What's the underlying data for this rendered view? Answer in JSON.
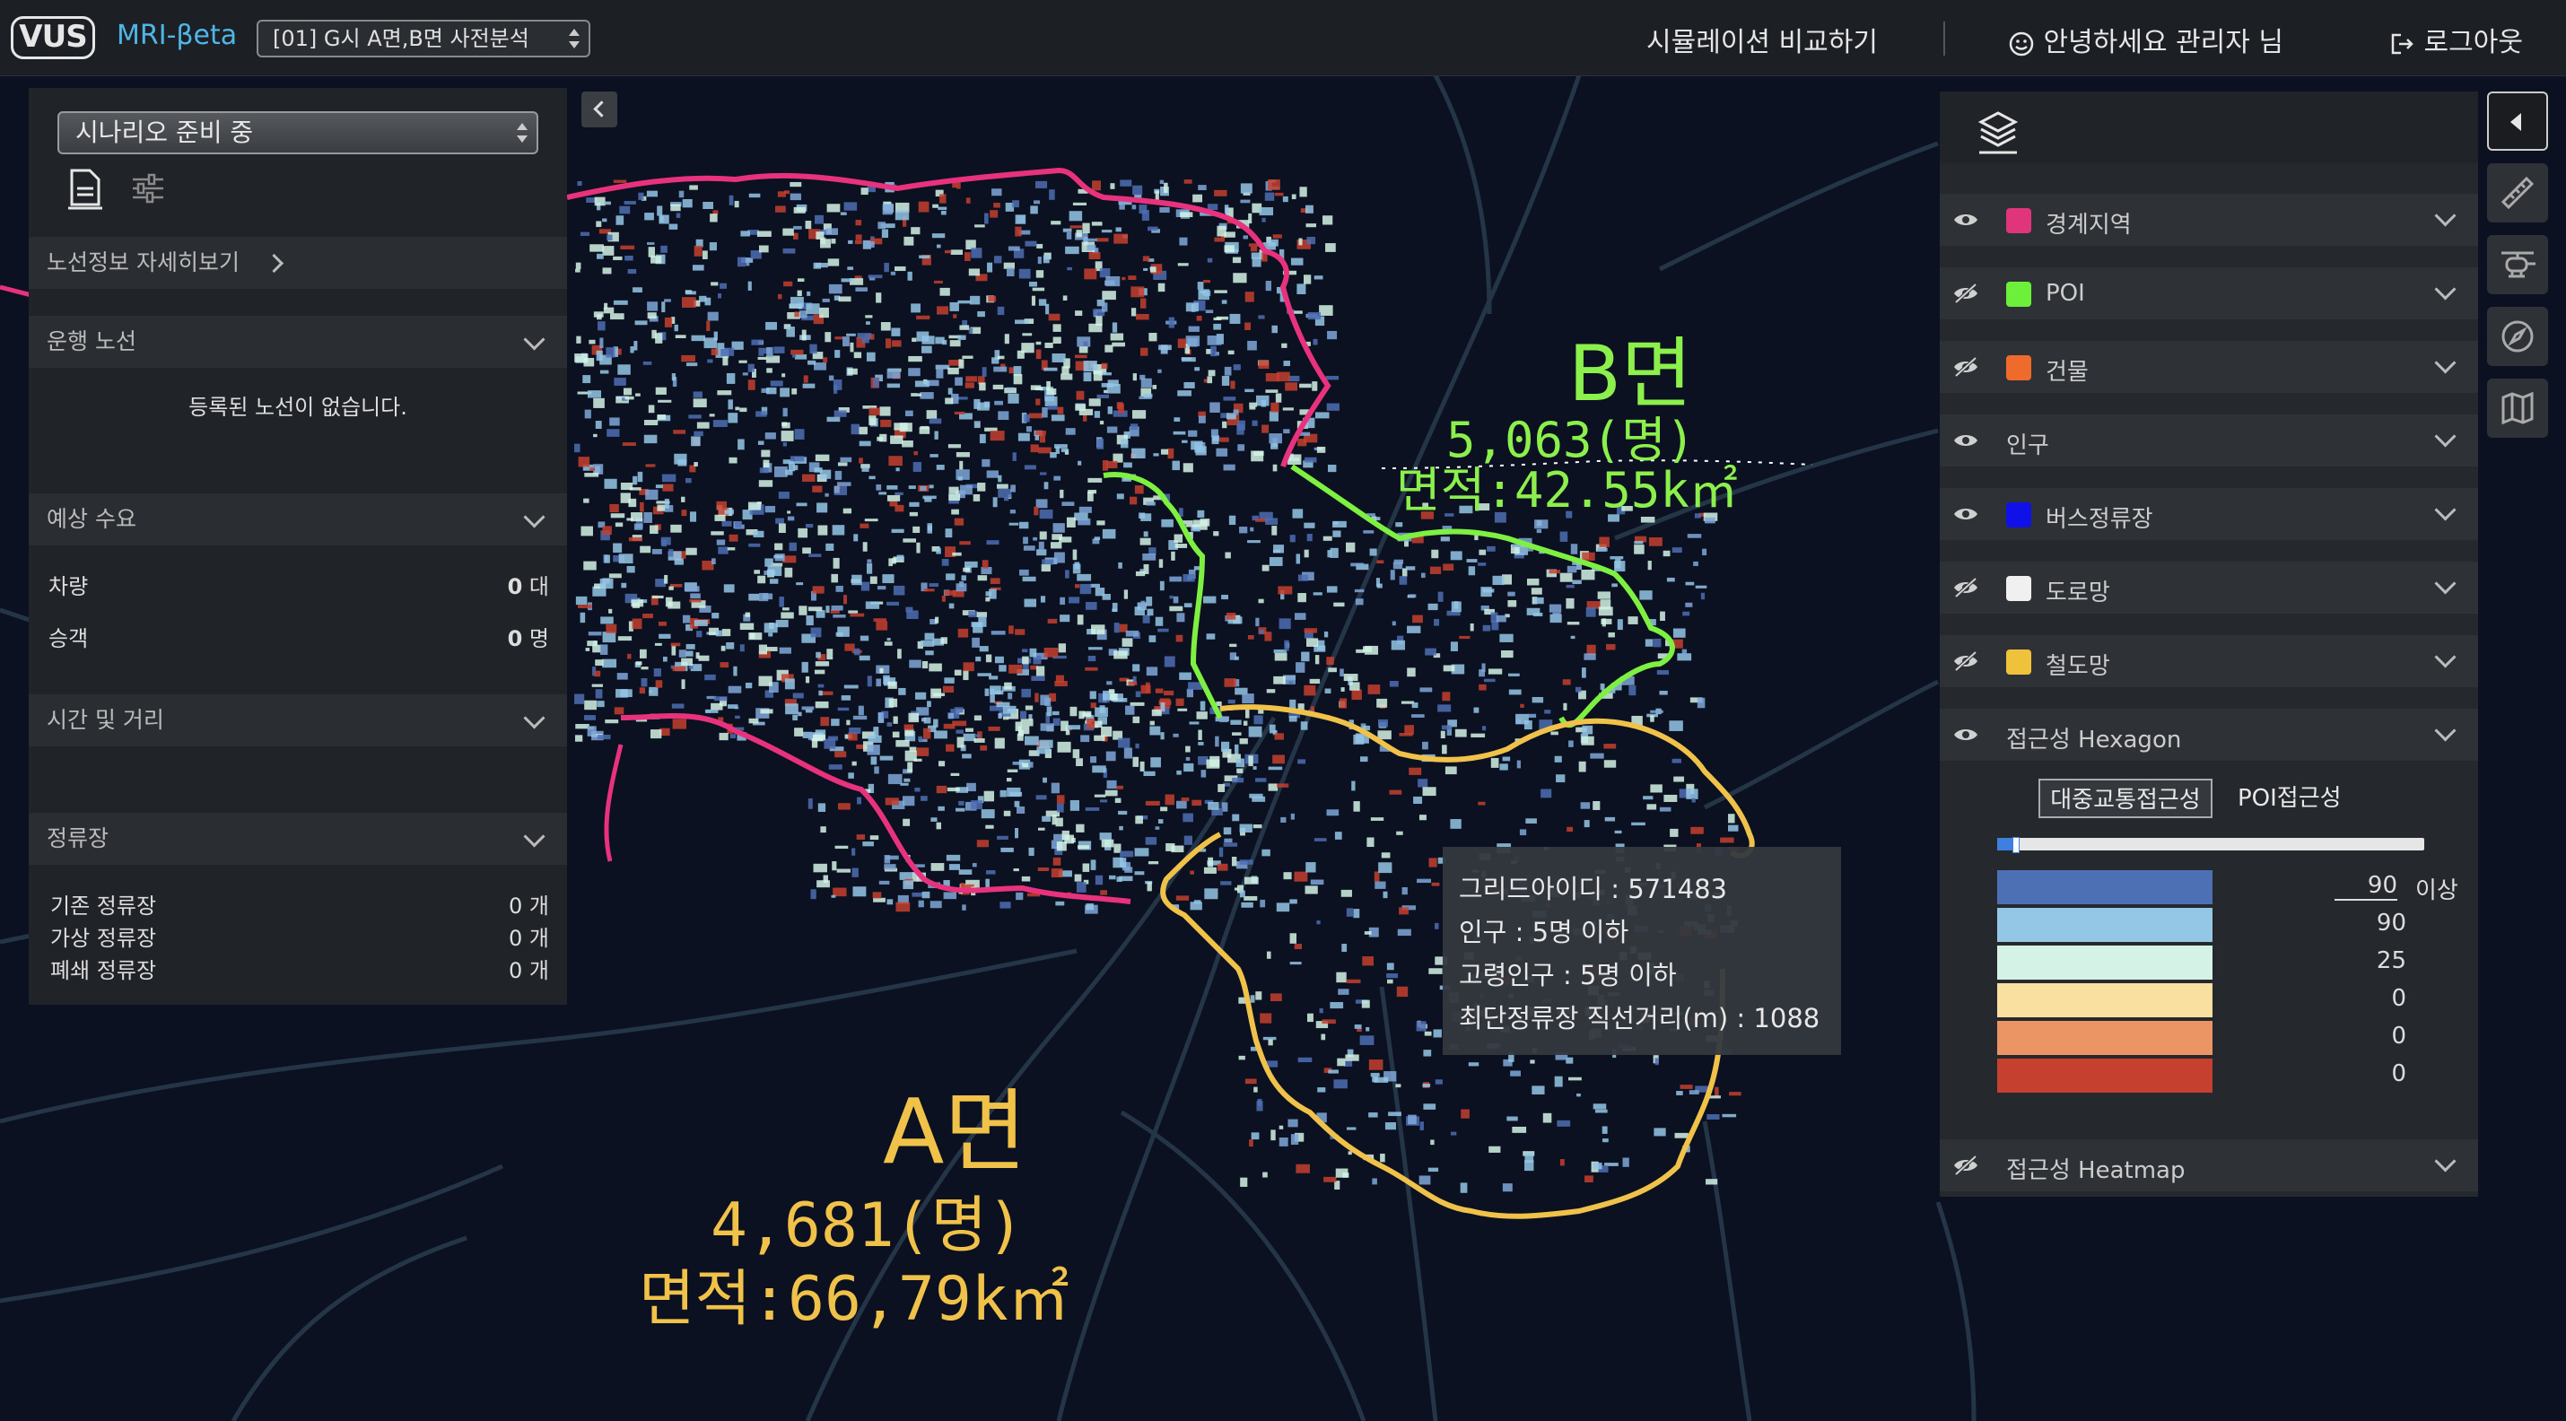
{
  "header": {
    "logo_text": "VUS",
    "app_name": "MRI-βeta",
    "scenario": "[01] G시 A면,B면 사전분석",
    "compare_label": "시뮬레이션 비교하기",
    "greeting": "안녕하세요 관리자 님",
    "logout_label": "로그아웃"
  },
  "left_panel": {
    "scenario_status": "시나리오 준비 중",
    "route_detail_link": "노선정보 자세히보기",
    "sections": {
      "operating_routes": {
        "title": "운행 노선",
        "empty_text": "등록된 노선이 없습니다."
      },
      "expected_demand": {
        "title": "예상 수요",
        "rows": [
          {
            "label": "차량",
            "value": "0",
            "unit": "대"
          },
          {
            "label": "승객",
            "value": "0",
            "unit": "명"
          }
        ]
      },
      "time_distance": {
        "title": "시간 및 거리"
      },
      "stops": {
        "title": "정류장",
        "rows": [
          {
            "label": "기존 정류장",
            "value": "0",
            "unit": "개"
          },
          {
            "label": "가상 정류장",
            "value": "0",
            "unit": "개"
          },
          {
            "label": "폐쇄 정류장",
            "value": "0",
            "unit": "개"
          }
        ]
      }
    }
  },
  "layers": [
    {
      "name": "경계지역",
      "color": "#e0357a",
      "visible": true
    },
    {
      "name": "POI",
      "color": "#6cf03a",
      "visible": false
    },
    {
      "name": "건물",
      "color": "#ef6b2c",
      "visible": false
    },
    {
      "name": "인구",
      "color": "",
      "visible": true
    },
    {
      "name": "버스정류장",
      "color": "#1010e8",
      "visible": true
    },
    {
      "name": "도로망",
      "color": "#f0f0f0",
      "visible": false
    },
    {
      "name": "철도망",
      "color": "#f0c23c",
      "visible": false
    },
    {
      "name": "접근성 Hexagon",
      "color": "",
      "visible": true
    },
    {
      "name": "접근성 Heatmap",
      "color": "",
      "visible": false
    }
  ],
  "accessibility": {
    "tabs": [
      "대중교통접근성",
      "POI접근성"
    ],
    "active_tab": "대중교통접근성",
    "slider_value": 0.04,
    "legend": [
      {
        "color": "#4d6fb4",
        "value": "90",
        "suffix": "이상"
      },
      {
        "color": "#94c6e6",
        "value": "90"
      },
      {
        "color": "#d4f3e6",
        "value": "25"
      },
      {
        "color": "#f9e0a0",
        "value": "0"
      },
      {
        "color": "#eb9464",
        "value": "0"
      },
      {
        "color": "#c6402f",
        "value": "0"
      }
    ]
  },
  "map": {
    "area_a": {
      "name": "A면",
      "population": "4,681(명)",
      "area": "면적:66,79k㎡",
      "color": "#f0c24a"
    },
    "area_b": {
      "name": "B면",
      "population": "5,063(명)",
      "area": "면적:42.55k㎡",
      "color": "#8cf04c"
    },
    "tooltip": [
      "그리드아이디 : 571483",
      "인구 : 5명 이하",
      "고령인구 : 5명 이하",
      "최단정류장 직선거리(m) : 1088"
    ]
  }
}
